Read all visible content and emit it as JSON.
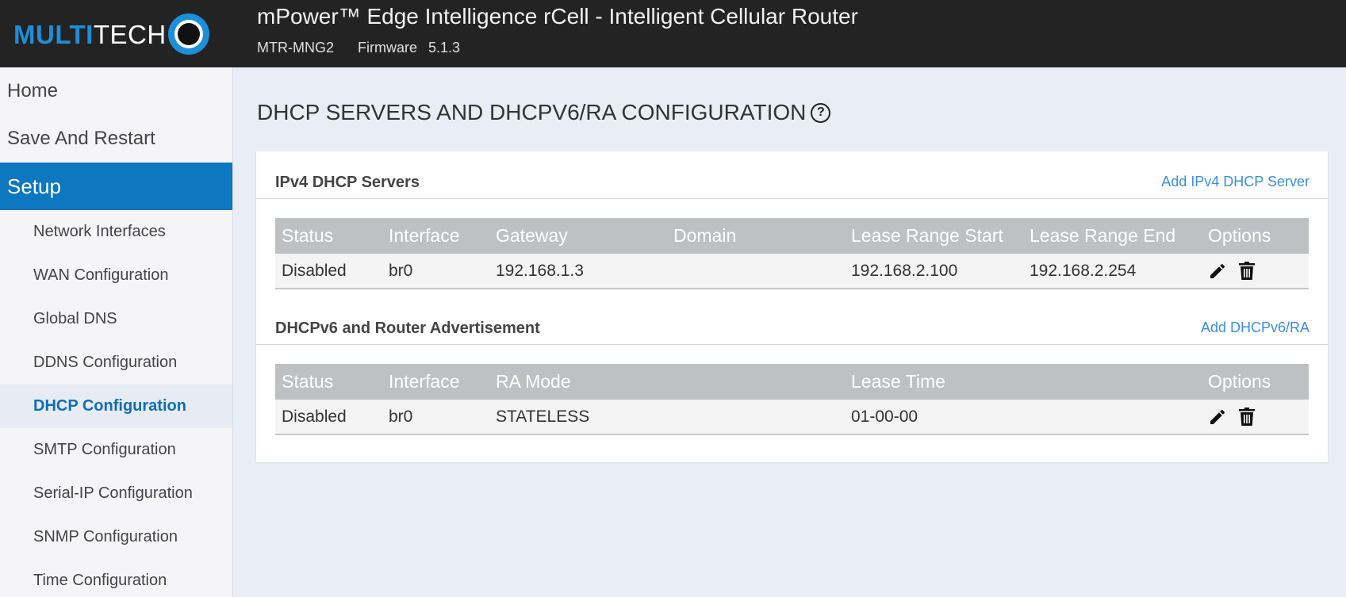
{
  "header": {
    "logo_multi": "MULTI",
    "logo_tech": "TECH",
    "title": "mPower™ Edge Intelligence rCell - Intelligent Cellular Router",
    "model": "MTR-MNG2",
    "firmware_label": "Firmware",
    "firmware_version": "5.1.3"
  },
  "sidebar": {
    "home": "Home",
    "save_restart": "Save And Restart",
    "setup": "Setup",
    "items": [
      "Network Interfaces",
      "WAN Configuration",
      "Global DNS",
      "DDNS Configuration",
      "DHCP Configuration",
      "SMTP Configuration",
      "Serial-IP Configuration",
      "SNMP Configuration",
      "Time Configuration"
    ]
  },
  "main": {
    "page_title": "DHCP SERVERS AND DHCPV6/RA CONFIGURATION",
    "help_glyph": "?",
    "ipv4": {
      "title": "IPv4 DHCP Servers",
      "add_link": "Add IPv4 DHCP Server",
      "columns": [
        "Status",
        "Interface",
        "Gateway",
        "Domain",
        "Lease Range Start",
        "Lease Range End",
        "Options"
      ],
      "rows": [
        {
          "status": "Disabled",
          "interface": "br0",
          "gateway": "192.168.1.3",
          "domain": "",
          "lease_start": "192.168.2.100",
          "lease_end": "192.168.2.254"
        }
      ]
    },
    "dhcpv6": {
      "title": "DHCPv6 and Router Advertisement",
      "add_link": "Add DHCPv6/RA",
      "columns": [
        "Status",
        "Interface",
        "RA Mode",
        "Lease Time",
        "Options"
      ],
      "rows": [
        {
          "status": "Disabled",
          "interface": "br0",
          "ra_mode": "STATELESS",
          "lease_time": "01-00-00"
        }
      ]
    }
  },
  "colors": {
    "accent": "#0d77c0",
    "link": "#3a8fe0",
    "header_bg": "#232323",
    "logo_blue": "#1d8ed8",
    "table_header": "#bfc0c4"
  }
}
